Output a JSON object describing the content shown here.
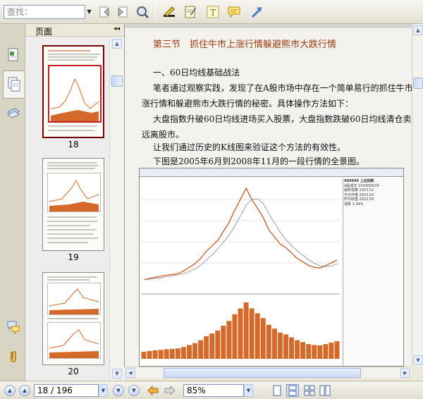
{
  "toolbar": {
    "search_placeholder": "查找：",
    "tools": [
      "prev-result-icon",
      "next-result-icon",
      "search-zoom-icon",
      "highlight-pen-icon",
      "note-pad-icon",
      "text-tool-icon",
      "comment-icon",
      "arrow-tool-icon"
    ]
  },
  "sidebar": {
    "panel_title": "页面",
    "collapse_glyph": "◂◂",
    "tabs": [
      "document-tab-icon",
      "pages-tab-icon",
      "layers-tab-icon"
    ],
    "bottom_tabs": [
      "comments-tab-icon",
      "attachments-tab-icon"
    ],
    "thumbnails": [
      {
        "page": "18",
        "selected": true
      },
      {
        "page": "19",
        "selected": false
      },
      {
        "page": "20",
        "selected": false
      }
    ]
  },
  "document": {
    "section_title": "第三节　抓住牛市上涨行情躲避熊市大跌行情",
    "subheading": "一、60日均线基础战法",
    "paragraph1_line1": "笔者通过观察实践，发现了在A股市场中存在一个简单易行的抓住牛市上",
    "paragraph1_line2": "涨行情和躲避熊市大跌行情的秘密。具体操作方法如下：",
    "paragraph2_line1": "大盘指数升破60日均线进场买入股票，大盘指数跌破60日均线清仓卖出",
    "paragraph2_line2": "远离股市。",
    "paragraph3": "让我们通过历史的K线图来验证这个方法的有效性。",
    "paragraph4": "下图是2005年6月到2008年11月的一段行情的全景图。"
  },
  "chart_data": {
    "type": "line",
    "title": "",
    "xlabel": "",
    "ylabel": "",
    "series": [
      {
        "name": "",
        "values": [
          1000,
          1080,
          1150,
          1200,
          1260,
          1300,
          1350,
          1500,
          1700,
          1900,
          2200,
          2600,
          2900,
          3200,
          3700,
          4200,
          4900,
          5500,
          6124,
          5500,
          5000,
          4500,
          3800,
          3400,
          3000,
          2800,
          2500,
          2200,
          2000,
          1800,
          1700,
          1664,
          1800,
          1950,
          2100
        ]
      }
    ],
    "side_panel_code": "999999 上证指数",
    "side_panel_rows": [
      "A股成交 15436562手",
      "最新指数 2923.52",
      "今日开盘 2933.02",
      "昨日收盘 2923.59",
      "涨跌 1.34%"
    ]
  },
  "statusbar": {
    "page_field": "18 / 196",
    "zoom_field": "85%"
  }
}
